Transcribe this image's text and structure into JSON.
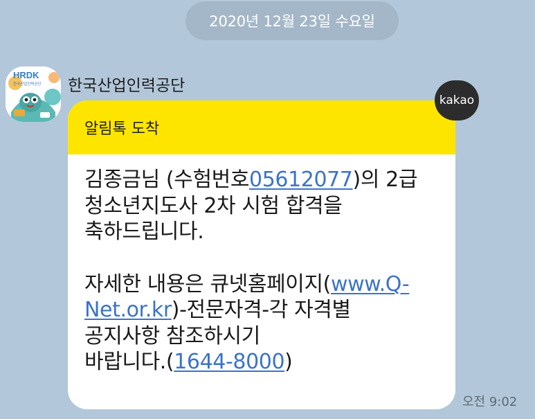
{
  "date_divider": "2020년 12월 23일 수요일",
  "sender": {
    "name": "한국산업인력공단",
    "avatar_logo": "HRDK",
    "avatar_subtext": "한국산업인력공단"
  },
  "badge": "kakao",
  "message": {
    "header": "알림톡 도착",
    "line1_a": "김종금님 (수험번호",
    "line1_link": "05612077",
    "line1_b": ")의 2급",
    "line2": "청소년지도사 2차 시험 합격을",
    "line3": "축하드립니다.",
    "line5": "자세한 내용은 큐넷홈페이지(",
    "line5_link": "www.Q-",
    "line6_link": "Net.or.kr",
    "line6_b": ")-전문자격-각 자격별",
    "line7": "공지사항 참조하시기",
    "line8_a": "바랍니다.(",
    "line8_link": "1644-8000",
    "line8_b": ")"
  },
  "time": "오전 9:02",
  "colors": {
    "background": "#b2c7d9",
    "header": "#fee500",
    "link": "#3a73c9",
    "badge": "#2c2c2c"
  }
}
